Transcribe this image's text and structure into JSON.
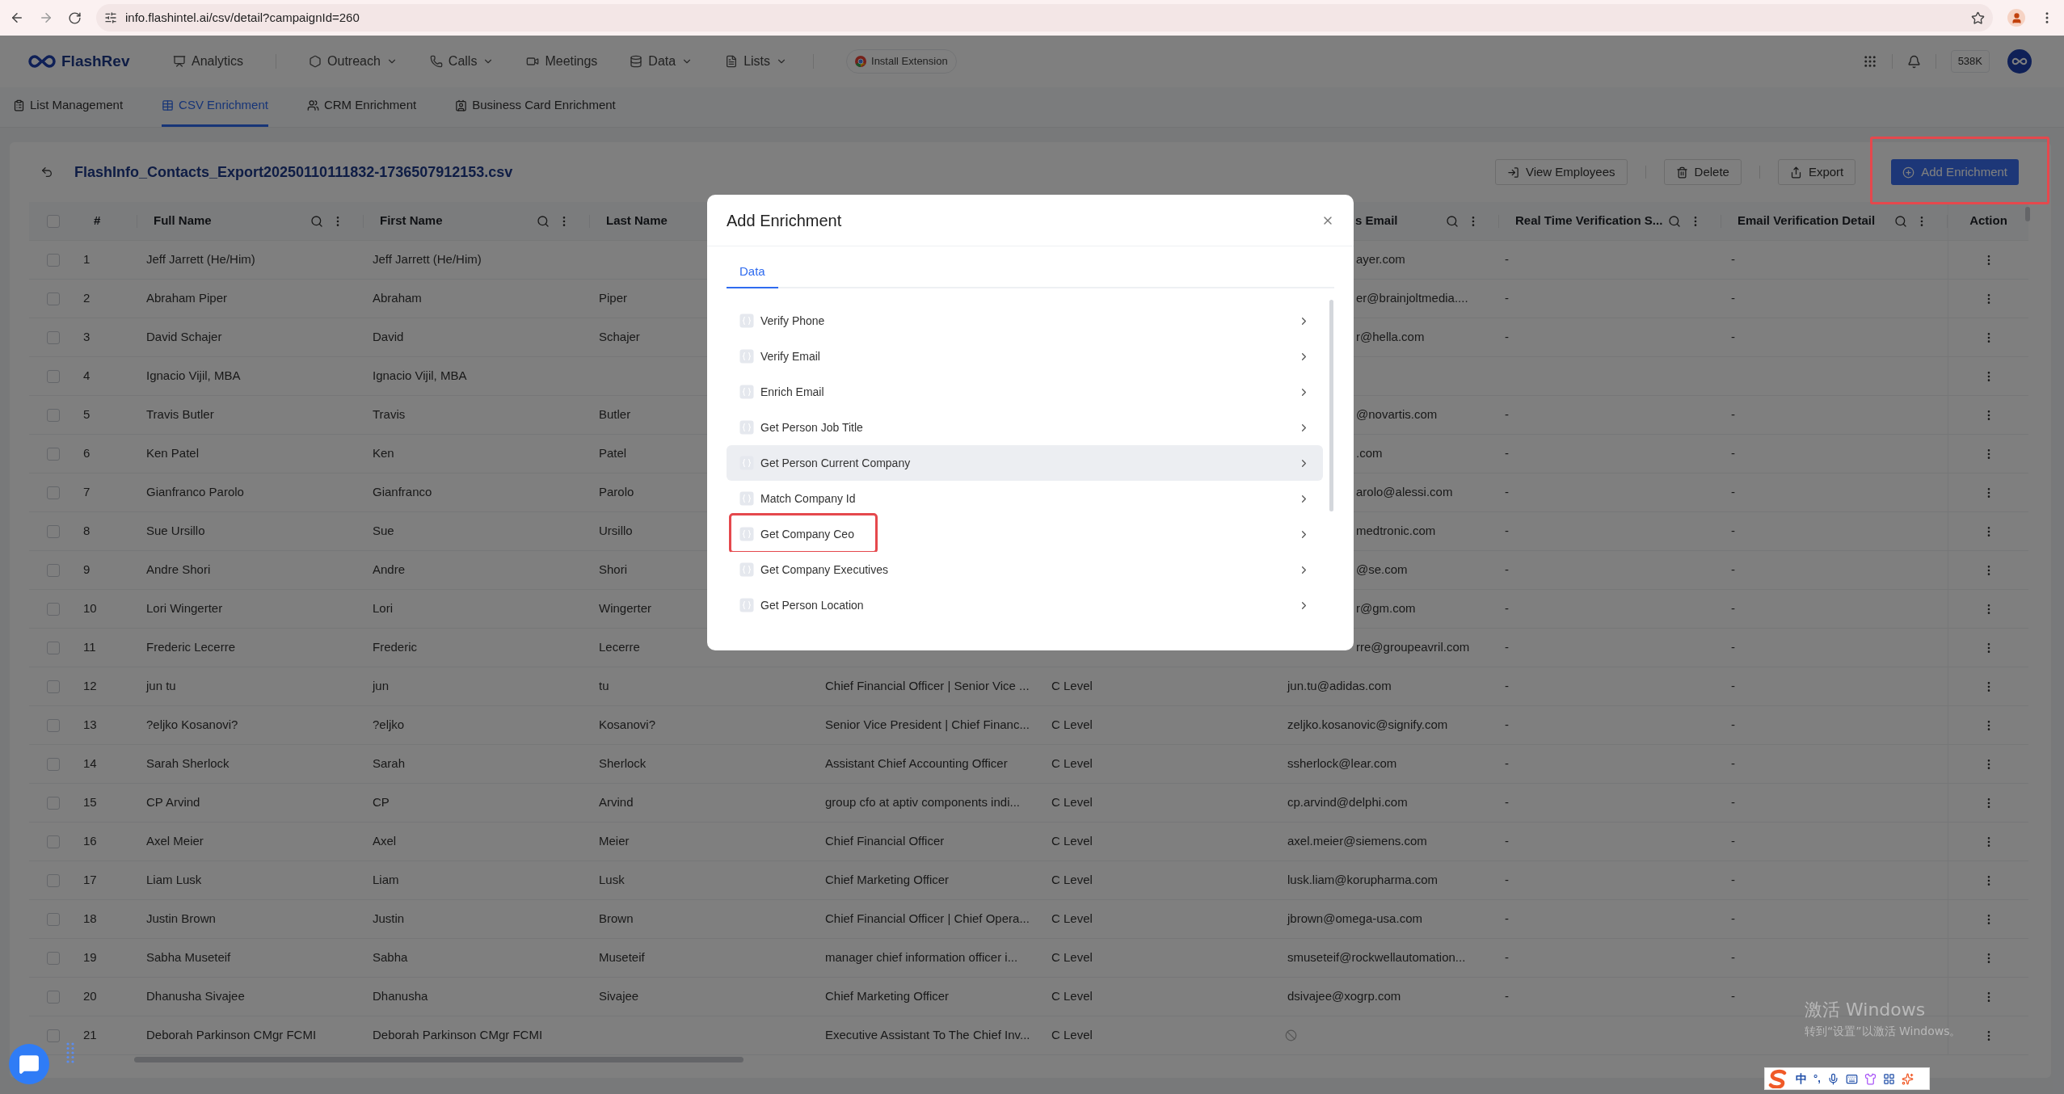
{
  "browser": {
    "url": "info.flashintel.ai/csv/detail?campaignId=260"
  },
  "nav": {
    "logo": "FlashRev",
    "items": [
      {
        "label": "Analytics",
        "caret": false
      },
      {
        "label": "Outreach",
        "caret": true
      },
      {
        "label": "Calls",
        "caret": true
      },
      {
        "label": "Meetings",
        "caret": false
      },
      {
        "label": "Data",
        "caret": true
      },
      {
        "label": "Lists",
        "caret": true
      }
    ],
    "extension": "Install Extension",
    "credits": "538K"
  },
  "subtabs": [
    {
      "label": "List Management",
      "selected": false
    },
    {
      "label": "CSV Enrichment",
      "selected": true
    },
    {
      "label": "CRM Enrichment",
      "selected": false
    },
    {
      "label": "Business Card Enrichment",
      "selected": false
    }
  ],
  "file_title": "FlashInfo_Contacts_Export20250110111832-1736507912153.csv",
  "actions": [
    {
      "label": "View Employees",
      "kind": "outline",
      "annotated": false
    },
    {
      "label": "Delete",
      "kind": "outline",
      "annotated": false
    },
    {
      "label": "Export",
      "kind": "outline",
      "annotated": false
    },
    {
      "label": "Add Enrichment",
      "kind": "primary",
      "annotated": true
    }
  ],
  "table": {
    "select_all": {
      "checked": false
    },
    "columns": [
      {
        "label": "#",
        "kind": "plain"
      },
      {
        "label": "Full Name",
        "kind": "tools"
      },
      {
        "label": "First Name",
        "kind": "tools"
      },
      {
        "label": "Last Name",
        "kind": "plain"
      },
      {
        "label": "s Email",
        "kind": "partial"
      },
      {
        "label": "Real Time Verification S...",
        "kind": "tools"
      },
      {
        "label": "Email Verification Detail",
        "kind": "tools"
      },
      {
        "label": "Action",
        "kind": "center"
      }
    ],
    "rows": [
      {
        "checked": false,
        "index": "1",
        "full_name": "Jeff Jarrett (He/Him)",
        "first_name": "Jeff Jarrett (He/Him)",
        "email": "ayer.com",
        "email_blocked": false,
        "verification": "-",
        "verification_detail": "-"
      },
      {
        "checked": false,
        "index": "2",
        "full_name": "Abraham Piper",
        "first_name": "Abraham",
        "last_name": "Piper",
        "email": "er@brainjoltmedia....",
        "email_blocked": false,
        "verification": "-",
        "verification_detail": "-"
      },
      {
        "checked": false,
        "index": "3",
        "full_name": "David Schajer",
        "first_name": "David",
        "last_name": "Schajer",
        "email": "r@hella.com",
        "email_blocked": false,
        "verification": "-",
        "verification_detail": "-"
      },
      {
        "checked": false,
        "index": "4",
        "full_name": "Ignacio Vijil, MBA",
        "first_name": "Ignacio Vijil, MBA",
        "email_blocked": false
      },
      {
        "checked": false,
        "index": "5",
        "full_name": "Travis Butler",
        "first_name": "Travis",
        "last_name": "Butler",
        "email": "@novartis.com",
        "email_blocked": false,
        "verification": "-",
        "verification_detail": "-"
      },
      {
        "checked": false,
        "index": "6",
        "full_name": "Ken Patel",
        "first_name": "Ken",
        "last_name": "Patel",
        "email": ".com",
        "email_blocked": false,
        "verification": "-",
        "verification_detail": "-"
      },
      {
        "checked": false,
        "index": "7",
        "full_name": "Gianfranco Parolo",
        "first_name": "Gianfranco",
        "last_name": "Parolo",
        "email": "arolo@alessi.com",
        "email_blocked": false,
        "verification": "-",
        "verification_detail": "-"
      },
      {
        "checked": false,
        "index": "8",
        "full_name": "Sue Ursillo",
        "first_name": "Sue",
        "last_name": "Ursillo",
        "email": "medtronic.com",
        "email_blocked": false,
        "verification": "-",
        "verification_detail": "-"
      },
      {
        "checked": false,
        "index": "9",
        "full_name": "Andre Shori",
        "first_name": "Andre",
        "last_name": "Shori",
        "email": "@se.com",
        "email_blocked": false,
        "verification": "-",
        "verification_detail": "-"
      },
      {
        "checked": false,
        "index": "10",
        "full_name": "Lori Wingerter",
        "first_name": "Lori",
        "last_name": "Wingerter",
        "email": "r@gm.com",
        "email_blocked": false,
        "verification": "-",
        "verification_detail": "-"
      },
      {
        "checked": false,
        "index": "11",
        "full_name": "Frederic Lecerre",
        "first_name": "Frederic",
        "last_name": "Lecerre",
        "email": "rre@groupeavril.com",
        "email_blocked": false,
        "verification": "-",
        "verification_detail": "-"
      },
      {
        "checked": false,
        "index": "12",
        "full_name": "jun tu",
        "first_name": "jun",
        "last_name": "tu",
        "title": "Chief Financial Officer | Senior Vice ...",
        "level": "C Level",
        "email": "jun.tu@adidas.com",
        "email_blocked": false,
        "verification": "-",
        "verification_detail": "-"
      },
      {
        "checked": false,
        "index": "13",
        "full_name": "?eljko Kosanovi?",
        "first_name": "?eljko",
        "last_name": "Kosanovi?",
        "title": "Senior Vice President | Chief Financ...",
        "level": "C Level",
        "email": "zeljko.kosanovic@signify.com",
        "email_blocked": false,
        "verification": "-",
        "verification_detail": "-"
      },
      {
        "checked": false,
        "index": "14",
        "full_name": "Sarah Sherlock",
        "first_name": "Sarah",
        "last_name": "Sherlock",
        "title": "Assistant Chief Accounting Officer",
        "level": "C Level",
        "email": "ssherlock@lear.com",
        "email_blocked": false,
        "verification": "-",
        "verification_detail": "-"
      },
      {
        "checked": false,
        "index": "15",
        "full_name": "CP Arvind",
        "first_name": "CP",
        "last_name": "Arvind",
        "title": "group cfo at aptiv components indi...",
        "level": "C Level",
        "email": "cp.arvind@delphi.com",
        "email_blocked": false,
        "verification": "-",
        "verification_detail": "-"
      },
      {
        "checked": false,
        "index": "16",
        "full_name": "Axel Meier",
        "first_name": "Axel",
        "last_name": "Meier",
        "title": "Chief Financial Officer",
        "level": "C Level",
        "email": "axel.meier@siemens.com",
        "email_blocked": false,
        "verification": "-",
        "verification_detail": "-"
      },
      {
        "checked": false,
        "index": "17",
        "full_name": "Liam Lusk",
        "first_name": "Liam",
        "last_name": "Lusk",
        "title": "Chief Marketing Officer",
        "level": "C Level",
        "email": "lusk.liam@korupharma.com",
        "email_blocked": false,
        "verification": "-",
        "verification_detail": "-"
      },
      {
        "checked": false,
        "index": "18",
        "full_name": "Justin Brown",
        "first_name": "Justin",
        "last_name": "Brown",
        "title": "Chief Financial Officer | Chief Opera...",
        "level": "C Level",
        "email": "jbrown@omega-usa.com",
        "email_blocked": false,
        "verification": "-",
        "verification_detail": "-"
      },
      {
        "checked": false,
        "index": "19",
        "full_name": "Sabha Museteif",
        "first_name": "Sabha",
        "last_name": "Museteif",
        "title": "manager chief information officer i...",
        "level": "C Level",
        "email": "smuseteif@rockwellautomation...",
        "email_blocked": false,
        "verification": "-",
        "verification_detail": "-"
      },
      {
        "checked": false,
        "index": "20",
        "full_name": "Dhanusha Sivajee",
        "first_name": "Dhanusha",
        "last_name": "Sivajee",
        "title": "Chief Marketing Officer",
        "level": "C Level",
        "email": "dsivajee@xogrp.com",
        "email_blocked": false,
        "verification": "-",
        "verification_detail": "-"
      },
      {
        "checked": false,
        "index": "21",
        "full_name": "Deborah Parkinson CMgr FCMI",
        "first_name": "Deborah Parkinson CMgr FCMI",
        "title": "Executive Assistant To The Chief Inv...",
        "level": "C Level",
        "email_blocked": true
      }
    ]
  },
  "modal": {
    "title": "Add Enrichment",
    "tabs": [
      {
        "label": "Data",
        "selected": true
      }
    ],
    "items": [
      {
        "label": "Verify Phone",
        "highlighted": false,
        "annotated": false
      },
      {
        "label": "Verify Email",
        "highlighted": false,
        "annotated": false
      },
      {
        "label": "Enrich Email",
        "highlighted": false,
        "annotated": false
      },
      {
        "label": "Get Person Job Title",
        "highlighted": false,
        "annotated": false
      },
      {
        "label": "Get Person Current Company",
        "highlighted": true,
        "annotated": false
      },
      {
        "label": "Match Company Id",
        "highlighted": false,
        "annotated": false
      },
      {
        "label": "Get Company Ceo",
        "highlighted": false,
        "annotated": true
      },
      {
        "label": "Get Company Executives",
        "highlighted": false,
        "annotated": false
      },
      {
        "label": "Get Person Location",
        "highlighted": false,
        "annotated": false
      }
    ]
  },
  "watermark": {
    "line1": "激活 Windows",
    "line2": "转到“设置”以激活 Windows。"
  },
  "ime": {
    "mode": "中",
    "punct": "°,"
  }
}
